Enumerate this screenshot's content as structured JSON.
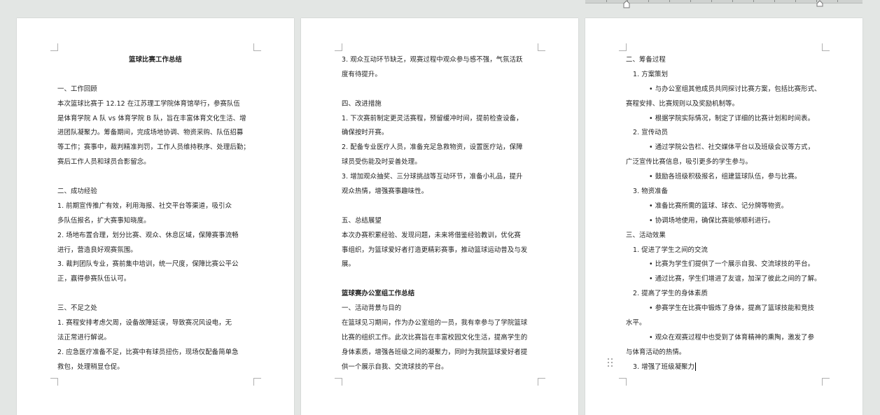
{
  "pages": [
    {
      "lines": [
        {
          "text": "篮球比赛工作总结",
          "cls": "bold center"
        },
        {
          "text": "",
          "cls": "blank"
        },
        {
          "text": "一、工作回顾",
          "cls": ""
        },
        {
          "text": " 本次篮球比赛于 12.12 在江苏理工学院体育馆举行，参赛队伍",
          "cls": ""
        },
        {
          "text": "是体育学院 A 队 vs 体育学院 B 队，旨在丰富体育文化生活、增",
          "cls": ""
        },
        {
          "text": "进团队凝聚力。筹备期间，完成场地协调、物资采购、队伍招募",
          "cls": ""
        },
        {
          "text": "等工作；赛事中，裁判精准判罚，工作人员维持秩序、处理后勤；",
          "cls": ""
        },
        {
          "text": "赛后工作人员和球员合影留念。",
          "cls": ""
        },
        {
          "text": "",
          "cls": "blank"
        },
        {
          "text": "二、成功经验",
          "cls": ""
        },
        {
          "text": " 1.  前期宣传推广有效，利用海报、社交平台等渠道，吸引众",
          "cls": ""
        },
        {
          "text": "多队伍报名，扩大赛事知晓度。",
          "cls": ""
        },
        {
          "text": "2.  场地布置合理，划分比赛、观众、休息区域，保障赛事流畅",
          "cls": ""
        },
        {
          "text": "进行，营造良好观赛氛围。",
          "cls": ""
        },
        {
          "text": "3.  裁判团队专业，赛前集中培训，统一尺度，保障比赛公平公",
          "cls": ""
        },
        {
          "text": "正，赢得参赛队伍认可。",
          "cls": ""
        },
        {
          "text": "",
          "cls": "blank"
        },
        {
          "text": "三、不足之处",
          "cls": ""
        },
        {
          "text": " 1.  赛程安排考虑欠周，设备故障延误，导致赛况风设电，无",
          "cls": ""
        },
        {
          "text": "法正常进行解说。",
          "cls": ""
        },
        {
          "text": "2.  应急医疗准备不足，比赛中有球员扭伤，现场仅配备简单急",
          "cls": ""
        },
        {
          "text": "救包，处理稍显仓促。",
          "cls": ""
        }
      ]
    },
    {
      "lines": [
        {
          "text": "3.  观众互动环节缺乏，观赛过程中观众参与感不强，气氛活跃",
          "cls": ""
        },
        {
          "text": "度有待提升。",
          "cls": ""
        },
        {
          "text": "",
          "cls": "blank"
        },
        {
          "text": "四、改进措施",
          "cls": ""
        },
        {
          "text": " 1.  下次赛前制定更灵活赛程，预留缓冲时间，提前检查设备，",
          "cls": ""
        },
        {
          "text": "确保按时开赛。",
          "cls": ""
        },
        {
          "text": "2.  配备专业医疗人员，准备充足急救物资，设置医疗站，保障",
          "cls": ""
        },
        {
          "text": "球员受伤能及时妥善处理。",
          "cls": ""
        },
        {
          "text": "3.  增加观众抽奖、三分球挑战等互动环节，准备小礼品，提升",
          "cls": ""
        },
        {
          "text": "观众热情，增强赛事趣味性。",
          "cls": ""
        },
        {
          "text": "",
          "cls": "blank"
        },
        {
          "text": "五、总结展望",
          "cls": ""
        },
        {
          "text": " 本次办赛积累经验、发现问题，未来将借鉴经验教训，优化赛",
          "cls": ""
        },
        {
          "text": "事组织，为篮球爱好者打造更精彩赛事，推动篮球运动普及与发",
          "cls": ""
        },
        {
          "text": "展。",
          "cls": ""
        },
        {
          "text": "",
          "cls": "blank"
        },
        {
          "text": "篮球赛办公室组工作总结",
          "cls": "bold"
        },
        {
          "text": "一、活动背景与目的",
          "cls": ""
        },
        {
          "text": "在篮球见习期间，作为办公室组的一员，我有幸参与了学院篮球",
          "cls": ""
        },
        {
          "text": "比赛的组织工作。此次比赛旨在丰富校园文化生活，提高学生的",
          "cls": ""
        },
        {
          "text": "身体素质，增强各班级之间的凝聚力，同时为我院篮球爱好者提",
          "cls": ""
        },
        {
          "text": "供一个展示自我、交流球技的平台。",
          "cls": ""
        }
      ]
    },
    {
      "lines": [
        {
          "text": "二、筹备过程",
          "cls": ""
        },
        {
          "text": "1.  方案策划",
          "cls": "ind1"
        },
        {
          "text": "•  与办公室组其他成员共同探讨比赛方案，包括比赛形式、",
          "cls": "ind3"
        },
        {
          "text": "赛程安排、比赛规则以及奖励机制等。",
          "cls": ""
        },
        {
          "text": "•  根据学院实际情况，制定了详细的比赛计划和时间表。",
          "cls": "ind3"
        },
        {
          "text": "2.  宣传动员",
          "cls": "ind1"
        },
        {
          "text": "•  通过学院公告栏、社交媒体平台以及班级会议等方式，",
          "cls": "ind3"
        },
        {
          "text": "广泛宣传比赛信息，吸引更多的学生参与。",
          "cls": ""
        },
        {
          "text": "•  鼓励各班级积极报名，组建篮球队伍，参与比赛。",
          "cls": "ind3"
        },
        {
          "text": "3.  物资准备",
          "cls": "ind1"
        },
        {
          "text": "•  准备比赛所需的篮球、球衣、记分牌等物资。",
          "cls": "ind3"
        },
        {
          "text": "•  协调场地使用，确保比赛能够顺利进行。",
          "cls": "ind3"
        },
        {
          "text": "三、活动效果",
          "cls": ""
        },
        {
          "text": "1.  促进了学生之间的交流",
          "cls": "ind1"
        },
        {
          "text": "•  比赛为学生们提供了一个展示自我、交流球技的平台。",
          "cls": "ind3"
        },
        {
          "text": "•  通过比赛，学生们增进了友谊，加深了彼此之间的了解。",
          "cls": "ind3"
        },
        {
          "text": "2.  提高了学生的身体素质",
          "cls": "ind1"
        },
        {
          "text": "•  参赛学生在比赛中锻炼了身体，提高了篮球技能和竞技",
          "cls": "ind3"
        },
        {
          "text": "水平。",
          "cls": ""
        },
        {
          "text": "•  观众在观赛过程中也受到了体育精神的熏陶，激发了参",
          "cls": "ind3"
        },
        {
          "text": "与体育活动的热情。",
          "cls": ""
        },
        {
          "text": "3.  增强了班级凝聚力",
          "cls": "ind1",
          "cursor": true
        }
      ]
    }
  ]
}
